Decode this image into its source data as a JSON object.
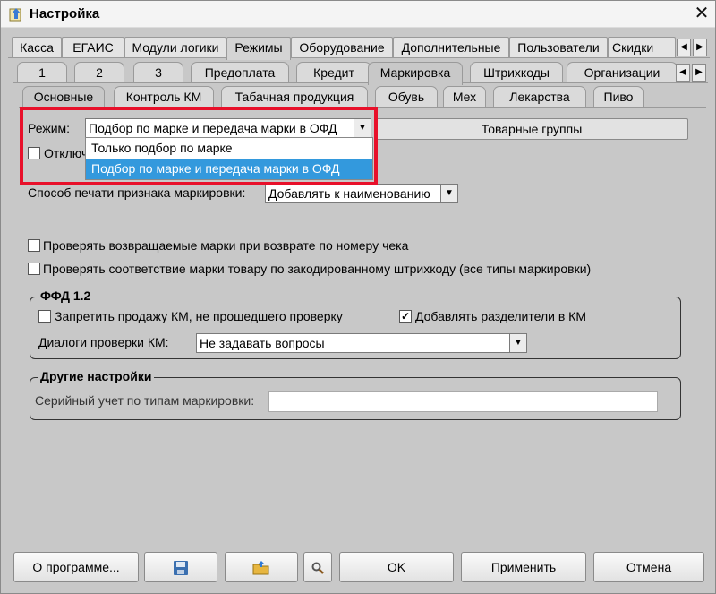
{
  "window": {
    "title": "Настройка",
    "close_glyph": "✕"
  },
  "tabs_main": [
    "Касса",
    "ЕГАИС",
    "Модули логики",
    "Режимы",
    "Оборудование",
    "Дополнительные",
    "Пользователи",
    "Скидки"
  ],
  "tabs_main_active": "Режимы",
  "tabs_sub": [
    "1",
    "2",
    "3",
    "Предоплата",
    "Кредит",
    "Маркировка",
    "Штрихкоды",
    "Организации"
  ],
  "tabs_sub_active": "Маркировка",
  "tabs_inner": [
    "Основные",
    "Контроль КМ",
    "Табачная продукция",
    "Обувь",
    "Мех",
    "Лекарства",
    "Пиво"
  ],
  "tabs_inner_active": "Основные",
  "scroll": {
    "left": "◀",
    "right": "▶"
  },
  "mode": {
    "label": "Режим:",
    "value": "Подбор по марке и передача марки в ОФД",
    "options": [
      "Только подбор по марке",
      "Подбор по марке и передача марки в ОФД"
    ],
    "selected_index": 1
  },
  "product_groups_button": "Товарные группы",
  "hidden_checkbox_label": "Отключ",
  "print_method": {
    "label": "Способ печати признака маркировки:",
    "value": "Добавлять к наименованию"
  },
  "checks": {
    "returned_marks": "Проверять возвращаемые марки при возврате по номеру чека",
    "mark_match": "Проверять соответствие марки товару по закодированному штрихкоду (все типы маркировки)"
  },
  "ffd": {
    "title": "ФФД 1.2",
    "forbid_sale": "Запретить продажу КМ, не прошедшего проверку",
    "forbid_sale_checked": false,
    "add_separators": "Добавлять разделители в КМ",
    "add_separators_checked": true,
    "dialogs_label": "Диалоги проверки КМ:",
    "dialogs_value": "Не задавать вопросы"
  },
  "other": {
    "title": "Другие настройки",
    "serial_label": "Серийный учет по типам маркировки:",
    "serial_value": ""
  },
  "buttons": {
    "about": "О программе...",
    "ok": "OK",
    "apply": "Применить",
    "cancel": "Отмена"
  },
  "colors": {
    "highlight": "#e8102a",
    "selection": "#3399dd"
  }
}
